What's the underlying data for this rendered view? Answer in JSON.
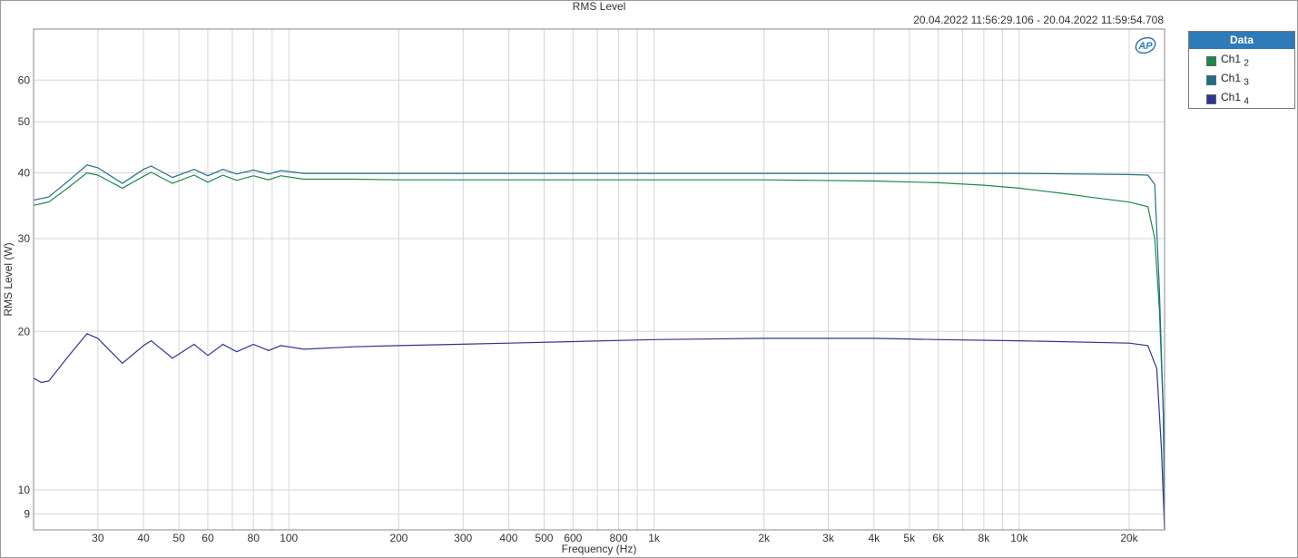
{
  "chart_data": {
    "type": "line",
    "title": "RMS Level",
    "timestamp": "20.04.2022 11:56:29.106 - 20.04.2022 11:59:54.708",
    "xlabel": "Frequency (Hz)",
    "ylabel": "RMS Level (W)",
    "x_scale": "log",
    "y_scale": "log",
    "xlim": [
      20,
      25000
    ],
    "ylim": [
      8.4,
      75
    ],
    "grid": true,
    "legend_title": "Data",
    "legend_position": "right",
    "x_ticks": [
      {
        "v": 30,
        "label": "30"
      },
      {
        "v": 40,
        "label": "40"
      },
      {
        "v": 50,
        "label": "50"
      },
      {
        "v": 60,
        "label": "60"
      },
      {
        "v": 80,
        "label": "80"
      },
      {
        "v": 100,
        "label": "100"
      },
      {
        "v": 200,
        "label": "200"
      },
      {
        "v": 300,
        "label": "300"
      },
      {
        "v": 400,
        "label": "400"
      },
      {
        "v": 500,
        "label": "500"
      },
      {
        "v": 600,
        "label": "600"
      },
      {
        "v": 800,
        "label": "800"
      },
      {
        "v": 1000,
        "label": "1k"
      },
      {
        "v": 2000,
        "label": "2k"
      },
      {
        "v": 3000,
        "label": "3k"
      },
      {
        "v": 4000,
        "label": "4k"
      },
      {
        "v": 5000,
        "label": "5k"
      },
      {
        "v": 6000,
        "label": "6k"
      },
      {
        "v": 8000,
        "label": "8k"
      },
      {
        "v": 10000,
        "label": "10k"
      },
      {
        "v": 20000,
        "label": "20k"
      }
    ],
    "x_minor": [
      70,
      90,
      700,
      900,
      7000,
      9000
    ],
    "y_ticks": [
      {
        "v": 9,
        "label": "9"
      },
      {
        "v": 10,
        "label": "10"
      },
      {
        "v": 20,
        "label": "20"
      },
      {
        "v": 30,
        "label": "30"
      },
      {
        "v": 40,
        "label": "40"
      },
      {
        "v": 50,
        "label": "50"
      },
      {
        "v": 60,
        "label": "60"
      }
    ],
    "series": [
      {
        "name": "Ch1 2",
        "label_main": "Ch1",
        "label_sub": "2",
        "color": "#1a8a4a",
        "points": [
          [
            20,
            34.7
          ],
          [
            22,
            35.2
          ],
          [
            25,
            37.6
          ],
          [
            28,
            40.0
          ],
          [
            30,
            39.6
          ],
          [
            35,
            37.4
          ],
          [
            40,
            39.4
          ],
          [
            42,
            40.1
          ],
          [
            48,
            38.2
          ],
          [
            55,
            39.6
          ],
          [
            60,
            38.4
          ],
          [
            66,
            39.6
          ],
          [
            72,
            38.7
          ],
          [
            80,
            39.5
          ],
          [
            88,
            38.8
          ],
          [
            95,
            39.5
          ],
          [
            110,
            38.9
          ],
          [
            150,
            38.9
          ],
          [
            200,
            38.8
          ],
          [
            400,
            38.8
          ],
          [
            1000,
            38.8
          ],
          [
            2000,
            38.8
          ],
          [
            4000,
            38.6
          ],
          [
            6000,
            38.3
          ],
          [
            8000,
            37.9
          ],
          [
            10000,
            37.4
          ],
          [
            13000,
            36.6
          ],
          [
            16000,
            35.9
          ],
          [
            20000,
            35.2
          ],
          [
            22500,
            34.5
          ],
          [
            23500,
            30
          ],
          [
            24200,
            22
          ],
          [
            24800,
            14
          ],
          [
            25000,
            8.4
          ]
        ]
      },
      {
        "name": "Ch1 3",
        "label_main": "Ch1",
        "label_sub": "3",
        "color": "#1f6e8c",
        "points": [
          [
            20,
            35.5
          ],
          [
            22,
            36.0
          ],
          [
            25,
            38.7
          ],
          [
            28,
            41.4
          ],
          [
            30,
            40.9
          ],
          [
            35,
            38.2
          ],
          [
            40,
            40.6
          ],
          [
            42,
            41.2
          ],
          [
            48,
            39.2
          ],
          [
            55,
            40.6
          ],
          [
            60,
            39.5
          ],
          [
            66,
            40.6
          ],
          [
            72,
            39.8
          ],
          [
            80,
            40.5
          ],
          [
            88,
            39.8
          ],
          [
            95,
            40.4
          ],
          [
            110,
            39.9
          ],
          [
            150,
            39.9
          ],
          [
            200,
            39.9
          ],
          [
            1000,
            39.9
          ],
          [
            5000,
            39.9
          ],
          [
            10000,
            39.9
          ],
          [
            20000,
            39.7
          ],
          [
            22500,
            39.6
          ],
          [
            23500,
            38
          ],
          [
            24200,
            24
          ],
          [
            24800,
            14
          ],
          [
            25000,
            8.4
          ]
        ]
      },
      {
        "name": "Ch1 4",
        "label_main": "Ch1",
        "label_sub": "4",
        "color": "#2e3593",
        "points": [
          [
            20,
            16.3
          ],
          [
            21,
            16.0
          ],
          [
            22,
            16.1
          ],
          [
            25,
            18.0
          ],
          [
            28,
            19.8
          ],
          [
            30,
            19.4
          ],
          [
            35,
            17.4
          ],
          [
            40,
            18.8
          ],
          [
            42,
            19.2
          ],
          [
            48,
            17.8
          ],
          [
            55,
            18.9
          ],
          [
            60,
            18.0
          ],
          [
            66,
            18.9
          ],
          [
            72,
            18.3
          ],
          [
            80,
            18.9
          ],
          [
            88,
            18.4
          ],
          [
            95,
            18.8
          ],
          [
            110,
            18.5
          ],
          [
            150,
            18.7
          ],
          [
            200,
            18.8
          ],
          [
            400,
            19.0
          ],
          [
            1000,
            19.3
          ],
          [
            2000,
            19.4
          ],
          [
            4000,
            19.4
          ],
          [
            6000,
            19.3
          ],
          [
            10000,
            19.2
          ],
          [
            20000,
            19.0
          ],
          [
            22500,
            18.8
          ],
          [
            23800,
            17
          ],
          [
            24500,
            12
          ],
          [
            25000,
            8.4
          ]
        ]
      }
    ]
  }
}
